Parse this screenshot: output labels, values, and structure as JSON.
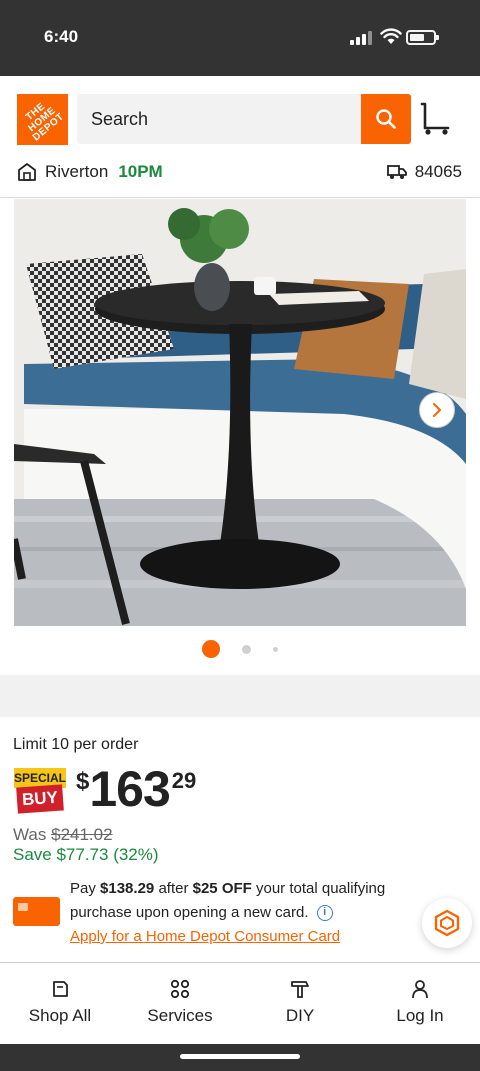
{
  "status_bar": {
    "time": "6:40"
  },
  "header": {
    "logo_text": "THE HOME DEPOT",
    "search_placeholder": "Search",
    "store_name": "Riverton",
    "store_time": "10PM",
    "zip": "84065"
  },
  "gallery": {
    "image_count": 3,
    "active_index": 0
  },
  "product": {
    "limit_text": "Limit 10 per order",
    "badge_line1": "SPECIAL",
    "badge_line2": "BUY",
    "price_currency": "$",
    "price_dollars": "163",
    "price_cents": "29",
    "was_label": "Was",
    "was_price": "$241.02",
    "save_text": "Save $77.73 (32%)"
  },
  "card_promo": {
    "text_pay": "Pay",
    "pay_amount": "$138.29",
    "text_after": "after",
    "off_amount": "$25 OFF",
    "text_rest": "your total qualifying purchase upon opening a new card.",
    "apply_link": "Apply for a Home Depot Consumer Card"
  },
  "bottom_nav": {
    "items": [
      {
        "label": "Shop All",
        "icon": "shop-all-icon"
      },
      {
        "label": "Services",
        "icon": "services-icon"
      },
      {
        "label": "DIY",
        "icon": "diy-icon"
      },
      {
        "label": "Log In",
        "icon": "user-icon"
      }
    ]
  },
  "colors": {
    "brand_orange": "#f96302",
    "store_green": "#1b8a3f",
    "status_bar": "#333333"
  }
}
